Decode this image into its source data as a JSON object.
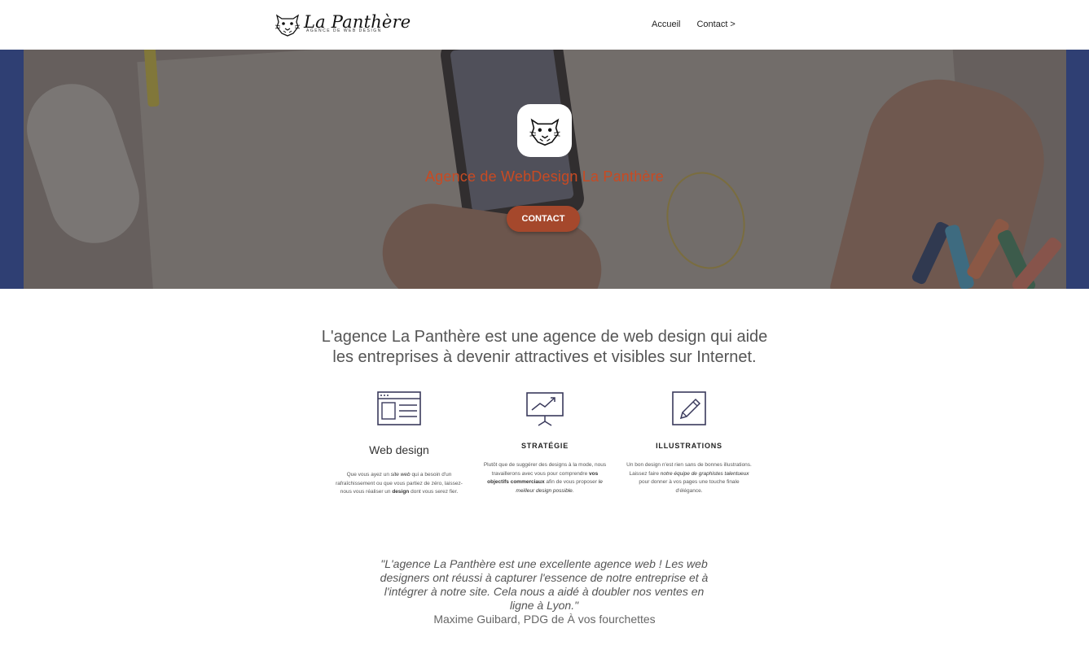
{
  "header": {
    "logo_text": "La Panthère",
    "logo_tagline": "AGENCE DE WEB DESIGN",
    "nav": [
      {
        "label": "Accueil"
      },
      {
        "label": "Contact >"
      }
    ]
  },
  "hero": {
    "title": "Agence de WebDesign La Panthère",
    "button_label": "CONTACT"
  },
  "intro": {
    "line1": "L'agence La Panthère est une agence de web design qui aide",
    "line2": "les entreprises à devenir attractives et visibles sur Internet."
  },
  "features": [
    {
      "icon": "browser-layout-icon",
      "title": "Web design",
      "desc_parts": [
        "Que vous ayez un ",
        "site web",
        " qui a besoin d'un rafraîchissement ou que vous partiez de zéro, laissez-nous vous réaliser un ",
        "design",
        " dont vous serez fier."
      ]
    },
    {
      "icon": "presentation-chart-icon",
      "title": "STRATÉGIE",
      "desc_parts": [
        "Plutôt que de suggérer des designs à la mode, nous travaillerons avec vous pour comprendre ",
        "vos objectifs commerciaux",
        " afin de vous proposer ",
        "le meilleur design possible",
        "."
      ]
    },
    {
      "icon": "pencil-edit-icon",
      "title": "ILLUSTRATIONS",
      "desc_parts": [
        "Un bon design n'est rien sans de bonnes illustrations. Laissez faire ",
        "notre équipe de graphistes talentueux",
        " pour donner à vos pages une touche finale d'élégance."
      ]
    }
  ],
  "testimonial": {
    "quote": "\"L'agence La Panthère est une excellente agence web ! Les web designers ont réussi à capturer l'essence de notre entreprise et à l'intégrer à notre site. Cela nous a aidé à doubler nos ventes en ligne à Lyon.\"",
    "author": "Maxime Guibard, PDG de À vos fourchettes"
  },
  "colors": {
    "accent": "#a5482c",
    "hero_title": "#c94a22",
    "icon_stroke": "#3a3a5c"
  }
}
